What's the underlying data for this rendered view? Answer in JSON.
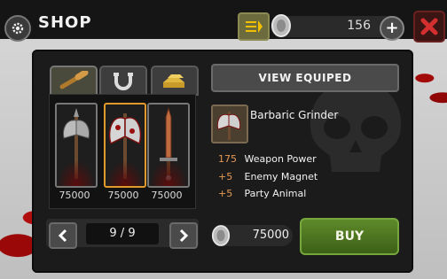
{
  "header": {
    "title": "SHOP",
    "currency_amount": "156"
  },
  "tabs": [
    {
      "name": "melee-weapons",
      "icon": "club-icon",
      "active": true
    },
    {
      "name": "magnet-perks",
      "icon": "magnet-icon",
      "active": false
    },
    {
      "name": "gold-perks",
      "icon": "gold-bars-icon",
      "active": false
    }
  ],
  "items": [
    {
      "name": "axe",
      "price": "75000",
      "selected": false
    },
    {
      "name": "barbaric-grinder",
      "price": "75000",
      "selected": true
    },
    {
      "name": "sword",
      "price": "75000",
      "selected": false
    }
  ],
  "pager": {
    "current": "9",
    "separator": "/",
    "total": "9",
    "label": "9 / 9"
  },
  "details": {
    "view_button": "VIEW EQUIPED",
    "weapon_name": "Barbaric Grinder",
    "stats": [
      {
        "value": "175",
        "label": "Weapon Power"
      },
      {
        "value": "+5",
        "label": "Enemy Magnet"
      },
      {
        "value": "+5",
        "label": "Party Animal"
      }
    ],
    "cost": "75000",
    "buy_label": "BUY"
  },
  "colors": {
    "accent_orange": "#e59a52",
    "selected_border": "#e09a2c",
    "buy_green": "#5e8a2a",
    "close_red": "#d32f2f"
  }
}
